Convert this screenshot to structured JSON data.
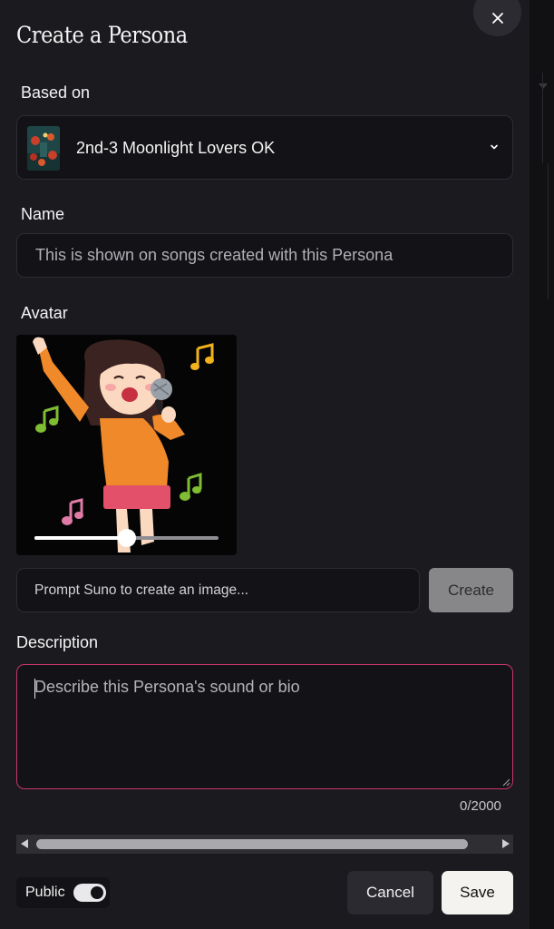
{
  "dialog": {
    "title": "Create a Persona",
    "close_icon": "close-icon"
  },
  "based_on": {
    "label": "Based on",
    "selected_song": "2nd-3 Moonlight Lovers OK",
    "chevron_icon": "chevron-down-icon"
  },
  "name": {
    "label": "Name",
    "value": "",
    "placeholder": "This is shown on songs created with this Persona"
  },
  "avatar": {
    "label": "Avatar",
    "image_icon": "singing-girl-illustration",
    "zoom_slider_value": 0.5
  },
  "image_prompt": {
    "value": "",
    "placeholder": "Prompt Suno to create an image...",
    "create_label": "Create"
  },
  "description": {
    "label": "Description",
    "value": "",
    "placeholder": "Describe this Persona's sound or bio",
    "counter": "0/2000"
  },
  "footer": {
    "public_label": "Public",
    "public_enabled": true,
    "cancel_label": "Cancel",
    "save_label": "Save"
  },
  "colors": {
    "background": "#1b1a1f",
    "input_bg": "#131216",
    "focus_border": "#c9366b",
    "save_bg": "#f5f3ef",
    "create_bg": "#87878a"
  }
}
